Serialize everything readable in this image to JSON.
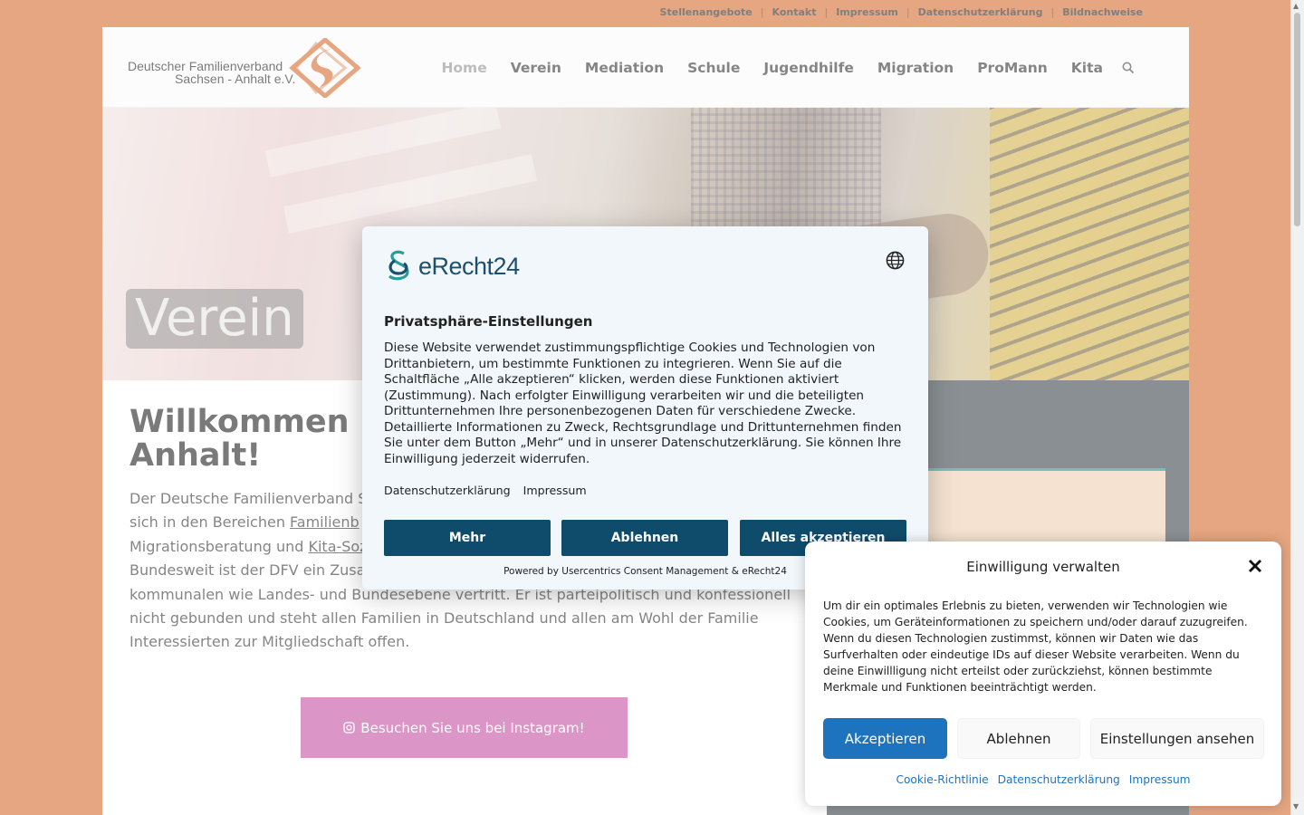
{
  "topbar": {
    "links": [
      "Stellenangebote",
      "Kontakt",
      "Impressum",
      "Datenschutzerklärung",
      "Bildnachweise"
    ],
    "separator": "|"
  },
  "header": {
    "logo_line1": "Deutscher Familienverband",
    "logo_line2": "Sachsen - Anhalt e.V.",
    "nav": [
      "Home",
      "Verein",
      "Mediation",
      "Schule",
      "Jugendhilfe",
      "Migration",
      "ProMann",
      "Kita"
    ],
    "active_nav": "Home",
    "search_icon": "search-icon"
  },
  "hero": {
    "title": "Verein"
  },
  "main": {
    "headline_part1": "Willkommen b",
    "headline_part2": "Anhalt!",
    "text_1": "Der Deutsche Familienverband S",
    "text_2": "sich in den Bereichen ",
    "link_1": "Familienb",
    "text_3": "Migrationsberatung und ",
    "link_2": "Kita-Soz",
    "text_4": "Bundesweit ist der DFV ein Zusa",
    "text_5": "kommunalen wie Landes- und Bundesebene vertritt. Er ist parteipolitisch und konfessionell nicht gebunden und steht allen Familien in Deutschland und allen am Wohl der Familie Interessierten zur Mitgliedschaft offen.",
    "instagram_button": "Besuchen Sie uns bei Instagram!",
    "instagram_icon": "instagram-icon"
  },
  "modal": {
    "brand": "eRecht24",
    "title": "Privatsphäre-Einstellungen",
    "text": "Diese Website verwendet zustimmungspflichtige Cookies und Technologien von Drittanbietern, um bestimmte Funktionen zu integrieren. Wenn Sie auf die Schaltfläche „Alle akzeptieren“ klicken, werden diese Funktionen aktiviert (Zustimmung). Nach erfolgter Einwilligung verarbeiten wir und die beteiligten Drittunternehmen Ihre personenbezogenen Daten für verschiedene Zwecke. Detaillierte Informationen zu Zweck, Rechtsgrundlage und Drittunternehmen finden Sie unter dem Button „Mehr“ und in unserer Datenschutzerklärung. Sie können Ihre Einwilligung jederzeit widerrufen.",
    "link_privacy": "Datenschutzerklärung",
    "link_imprint": "Impressum",
    "btn_more": "Mehr",
    "btn_deny": "Ablehnen",
    "btn_accept_all": "Alles akzeptieren",
    "powered_by": "Powered by Usercentrics Consent Management & eRecht24"
  },
  "consent": {
    "title": "Einwilligung verwalten",
    "text": "Um dir ein optimales Erlebnis zu bieten, verwenden wir Technologien wie Cookies, um Geräteinformationen zu speichern und/oder darauf zuzugreifen. Wenn du diesen Technologien zustimmst, können wir Daten wie das Surfverhalten oder eindeutige IDs auf dieser Website verarbeiten. Wenn du deine Einwillligung nicht erteilst oder zurückziehst, können bestimmte Merkmale und Funktionen beeinträchtigt werden.",
    "btn_accept": "Akzeptieren",
    "btn_deny": "Ablehnen",
    "btn_prefs": "Einstellungen ansehen",
    "links": [
      "Cookie-Richtlinie",
      "Datenschutzerklärung",
      "Impressum"
    ]
  },
  "colors": {
    "brand_orange": "#d7773e",
    "modal_button": "#0f4c6b",
    "consent_accept": "#1e73be",
    "instagram_button": "#c95caa"
  }
}
